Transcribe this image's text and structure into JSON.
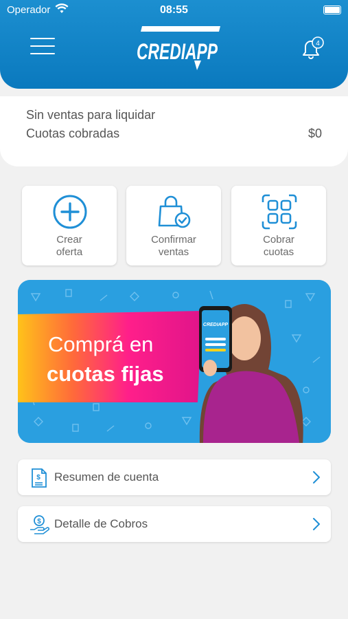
{
  "status_bar": {
    "carrier": "Operador",
    "time": "08:55"
  },
  "header": {
    "logo_text": "CREDIAPP",
    "notifications_count": "4"
  },
  "summary": {
    "line1": "Sin ventas para liquidar",
    "line2": "Cuotas cobradas",
    "amount": "$0"
  },
  "actions": [
    {
      "line1": "Crear",
      "line2": "oferta"
    },
    {
      "line1": "Confirmar",
      "line2": "ventas"
    },
    {
      "line1": "Cobrar",
      "line2": "cuotas"
    }
  ],
  "banner": {
    "line1": "Comprá en",
    "line2": "cuotas fijas",
    "phone_logo": "CREDIAPP"
  },
  "menu_rows": [
    {
      "label": "Resumen de cuenta"
    },
    {
      "label": "Detalle de Cobros"
    }
  ],
  "colors": {
    "primary": "#0a79be",
    "accent": "#1f8fd6",
    "background": "#f1f1f1"
  }
}
